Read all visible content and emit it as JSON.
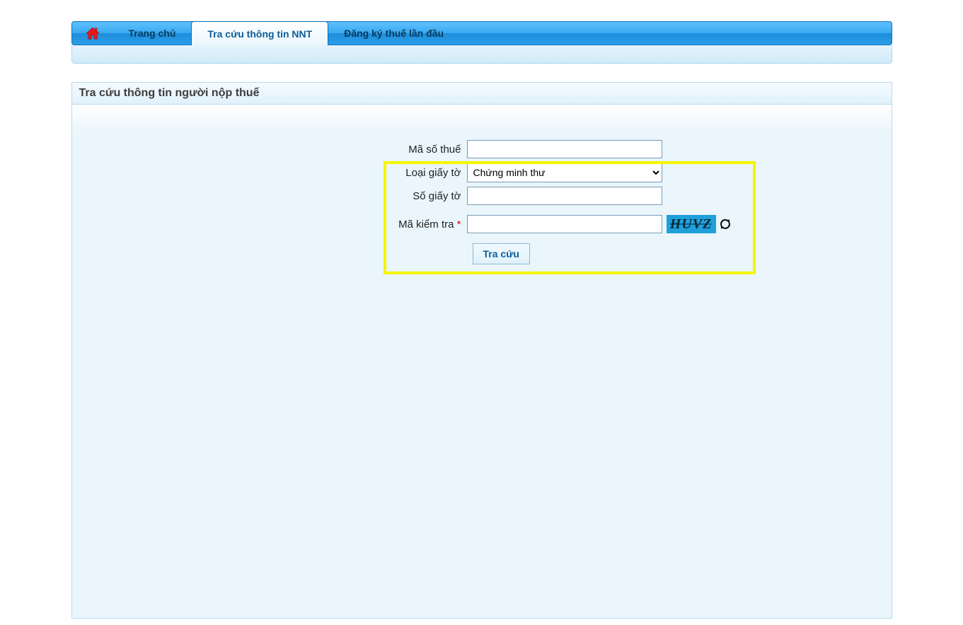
{
  "nav": {
    "home_label": "Trang chủ",
    "lookup_label": "Tra cứu thông tin NNT",
    "register_label": "Đăng ký thuế lần đầu"
  },
  "panel": {
    "title": "Tra cứu thông tin người nộp thuế"
  },
  "form": {
    "tax_code_label": "Mã số thuế",
    "tax_code_value": "",
    "doc_type_label": "Loại giấy tờ",
    "doc_type_selected": "Chứng minh thư",
    "doc_number_label": "Số giấy tờ",
    "doc_number_value": "",
    "captcha_label": "Mã kiểm tra",
    "captcha_required": "*",
    "captcha_value": "",
    "captcha_image_text": "HUVZ",
    "submit_label": "Tra cứu"
  }
}
